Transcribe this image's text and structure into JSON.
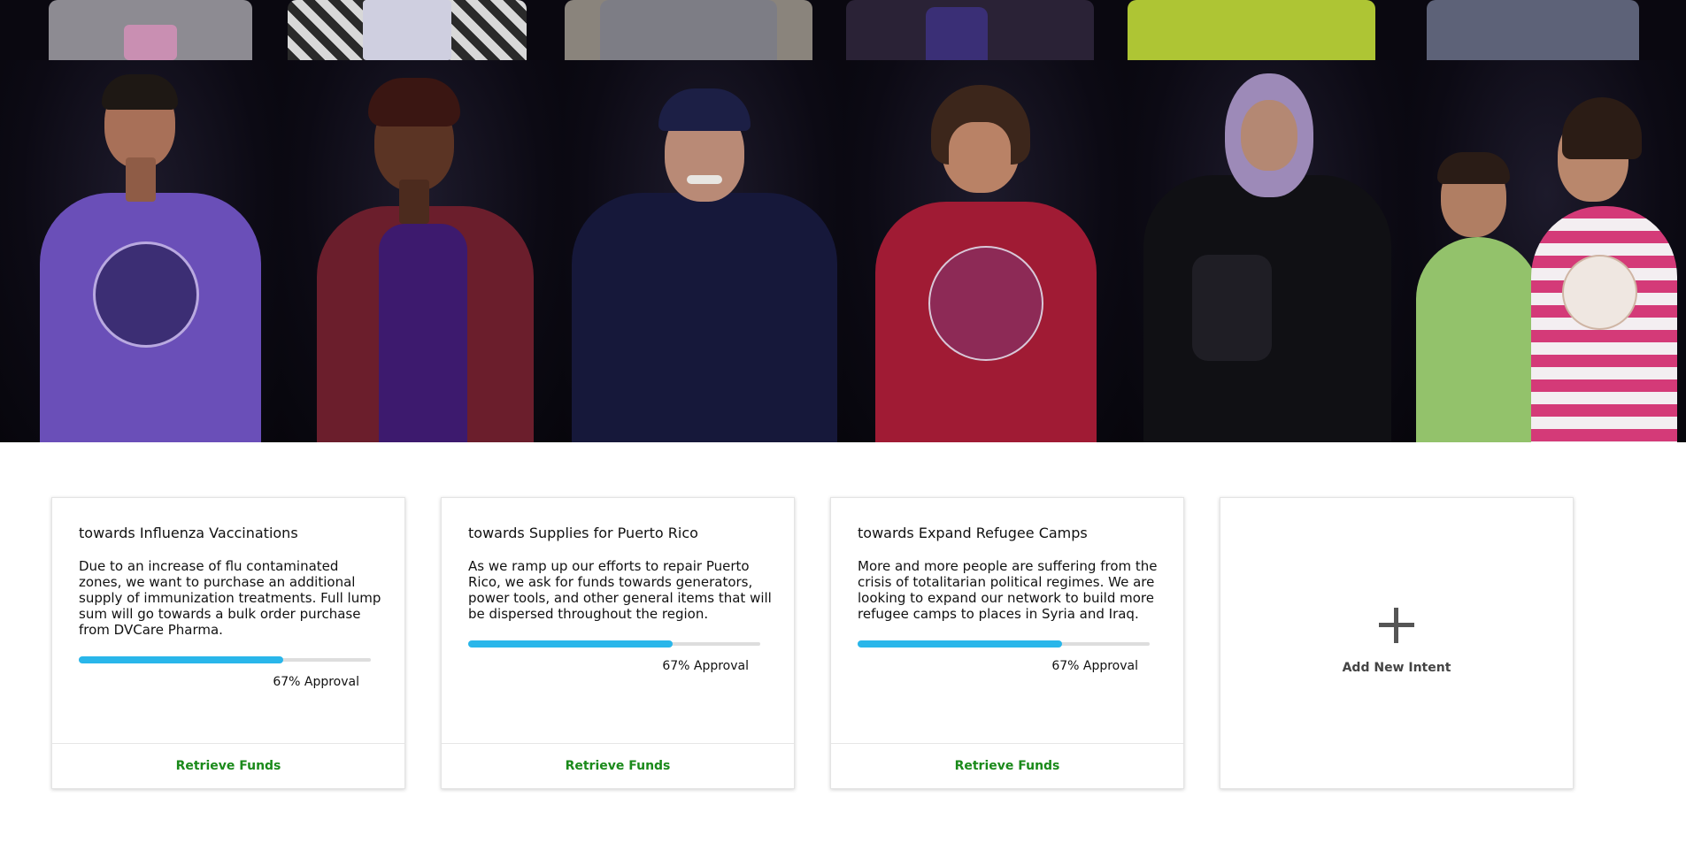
{
  "hero": {
    "photo_description_note": ""
  },
  "intents": [
    {
      "title": "towards Influenza Vaccinations",
      "description": "Due to an increase of flu contaminated zones, we want to purchase an additional supply of immunization treatments. Full lump sum will go towards a bulk order purchase from DVCare Pharma.",
      "approval_fraction": 0.7,
      "approval_text": "67% Approval",
      "button_label": "Retrieve Funds"
    },
    {
      "title": "towards Supplies for Puerto Rico",
      "description": "As we ramp up our efforts to repair Puerto Rico, we ask for funds towards generators, power tools, and other general items that will be dispersed throughout the region.",
      "approval_fraction": 0.7,
      "approval_text": "67% Approval",
      "button_label": "Retrieve Funds"
    },
    {
      "title": "towards Expand Refugee Camps",
      "description": "More and more people are suffering from the crisis of totalitarian political regimes. We are looking to expand our network to build more refugee camps to places in Syria and Iraq.",
      "approval_fraction": 0.7,
      "approval_text": "67% Approval",
      "button_label": "Retrieve Funds"
    }
  ],
  "add_intent": {
    "label": "Add New Intent",
    "icon": "plus-icon"
  },
  "colors": {
    "progress": "#29b6ea",
    "action_green": "#1a8a1a"
  }
}
